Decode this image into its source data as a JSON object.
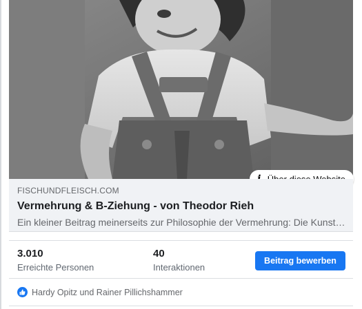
{
  "link_preview": {
    "about_site_label": "Über diese Website",
    "domain": "FISCHUNDFLEISCH.COM",
    "title": "Vermehrung & B-Ziehung - von Theodor Rieh",
    "description": "Ein kleiner Beitrag meinerseits zur Philosophie der Vermehrung: Die Kunst der Vermehrung ist eine sehr alte"
  },
  "insights": {
    "reach": {
      "value": "3.010",
      "label": "Erreichte Personen"
    },
    "interactions": {
      "value": "40",
      "label": "Interaktionen"
    },
    "boost_label": "Beitrag bewerben"
  },
  "reactions": {
    "icon": "like-icon",
    "names": "Hardy Opitz und Rainer Pillichshammer",
    "color": "#1877f2"
  }
}
